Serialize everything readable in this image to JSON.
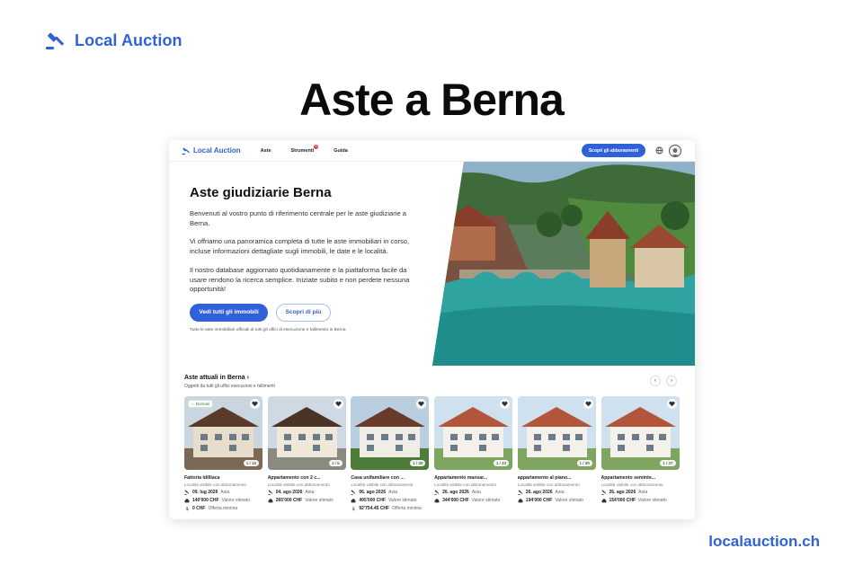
{
  "brand": {
    "name": "Local Auction"
  },
  "headline": "Aste a Berna",
  "footer_url": "localauction.ch",
  "screenshot": {
    "nav": {
      "logo": "Local Auction",
      "links": [
        "Aste",
        "Strumenti",
        "Guida"
      ],
      "badge": "1",
      "cta": "Scopri gli abbonamenti"
    },
    "hero": {
      "title": "Aste giudiziarie Berna",
      "p1": "Benvenuti al vostro punto di riferimento centrale per le aste giudiziarie a Berna.",
      "p2": "Vi offriamo una panoramica completa di tutte le aste immobiliari in corso, incluse informazioni dettagliate sugli immobili, le date e le località.",
      "p3": "Il nostro database aggiornato quotidianamente e la piattaforma facile da usare rendono la ricerca semplice. Iniziate subito e non perdete nessuna opportunità!",
      "btn_primary": "Vedi tutti gli immobili",
      "btn_secondary": "Scopri di più",
      "note": "Tutte le aste immobiliari ufficiali di tutti gli uffici di esecuzione e fallimento in Berna"
    },
    "section": {
      "title": "Aste attuali in Berna ›",
      "subtitle": "Oggetti da tutti gli uffici esecuzioni e fallimenti"
    },
    "cards": [
      {
        "title": "Fattoria idilliaca",
        "location": "Località visibile con abbonamento",
        "count": "1 / 16",
        "tag": "Domani",
        "date": "09. lug 2026",
        "date_label": "Asta",
        "value": "140'000 CHF",
        "value_label": "Valore stimato",
        "min": "0 CHF",
        "min_label": "Offerta minima"
      },
      {
        "title": "Appartamento con 2 c...",
        "location": "Località visibile con abbonamento",
        "count": "1 / 5",
        "tag": "",
        "date": "04. ago 2026",
        "date_label": "Asta",
        "value": "265'000 CHF",
        "value_label": "Valore stimato",
        "min": "",
        "min_label": ""
      },
      {
        "title": "Casa unifamiliare con ...",
        "location": "Località visibile con abbonamento",
        "count": "1 / 30",
        "tag": "",
        "date": "06. ago 2026",
        "date_label": "Asta",
        "value": "495'000 CHF",
        "value_label": "Valore stimato",
        "min": "92'754.45 CHF",
        "min_label": "Offerta minima"
      },
      {
        "title": "Appartamento mansar...",
        "location": "Località visibile con abbonamento",
        "count": "1 / 43",
        "tag": "",
        "date": "26. ago 2026",
        "date_label": "Asta",
        "value": "344'000 CHF",
        "value_label": "Valore stimato",
        "min": "",
        "min_label": ""
      },
      {
        "title": "appartamento al piano...",
        "location": "Località visibile con abbonamento",
        "count": "1 / 39",
        "tag": "",
        "date": "26. ago 2026",
        "date_label": "Asta",
        "value": "194'000 CHF",
        "value_label": "Valore stimato",
        "min": "",
        "min_label": ""
      },
      {
        "title": "Appartamento seminte...",
        "location": "Località visibile con abbonamento",
        "count": "1 / 37",
        "tag": "",
        "date": "26. ago 2026",
        "date_label": "Asta",
        "value": "154'000 CHF",
        "value_label": "Valore stimato",
        "min": "",
        "min_label": ""
      }
    ]
  },
  "colors": {
    "accent": "#2f62d8"
  }
}
